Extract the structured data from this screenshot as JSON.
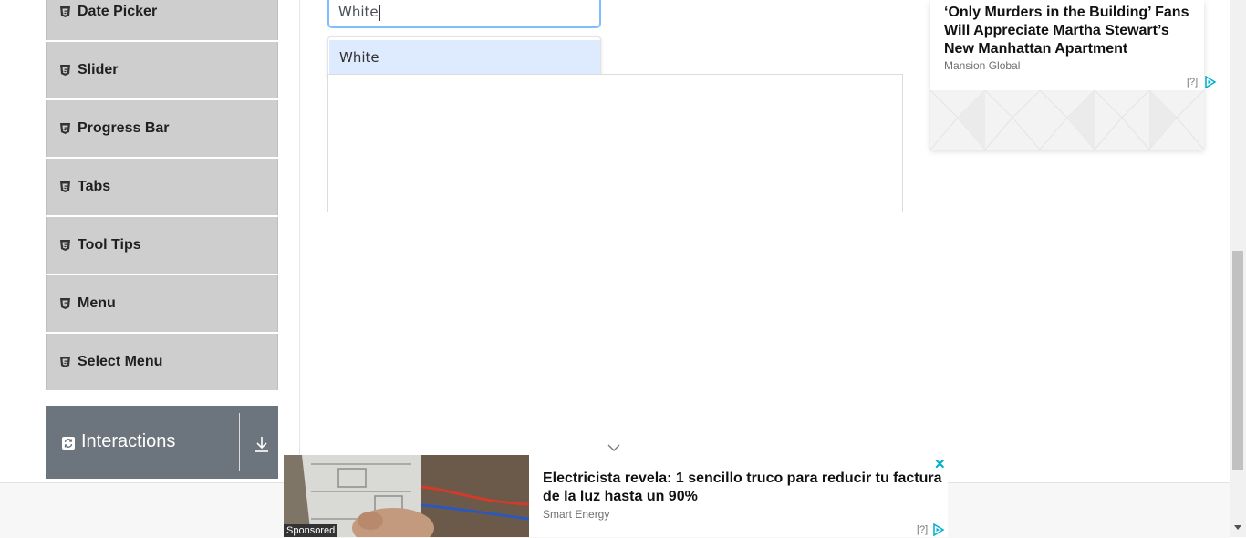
{
  "sidebar": {
    "items": [
      {
        "label": "Date Picker"
      },
      {
        "label": "Slider"
      },
      {
        "label": "Progress Bar"
      },
      {
        "label": "Tabs"
      },
      {
        "label": "Tool Tips"
      },
      {
        "label": "Menu"
      },
      {
        "label": "Select Menu"
      }
    ],
    "group": {
      "label": "Interactions"
    }
  },
  "autocomplete": {
    "input_value": "White",
    "suggestions": [
      {
        "label": "White"
      }
    ]
  },
  "ads": {
    "right": {
      "headline": "‘Only Murders in the Building’ Fans Will Appreciate Martha Stewart’s New Manhattan Apartment",
      "source": "Mansion Global",
      "info": "[?]"
    },
    "bottom": {
      "headline": "Electricista revela: 1 sencillo truco para reducir tu factura de la luz hasta un 90%",
      "source": "Smart Energy",
      "badge": "Sponsored",
      "close": "✕",
      "info": "[?]"
    }
  },
  "colors": {
    "sidebar_item_bg": "#cecece",
    "group_header_bg": "#6c757d",
    "input_focus_border": "#80bdff",
    "suggestion_highlight": "#deebff",
    "ad_close": "#00aecd"
  }
}
